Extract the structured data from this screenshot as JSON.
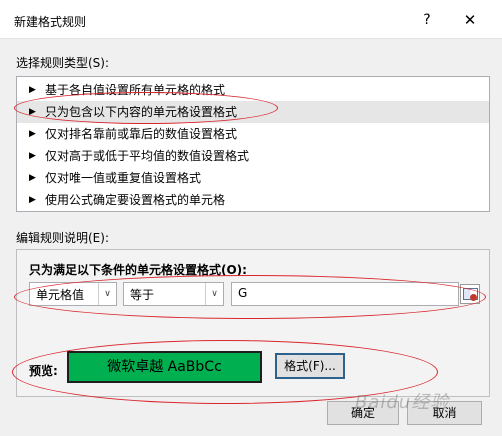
{
  "dialog": {
    "title": "新建格式规则",
    "help": "?",
    "close": "✕"
  },
  "rule_type": {
    "label": "选择规则类型(S):",
    "items": [
      {
        "label": "基于各自值设置所有单元格的格式",
        "selected": false
      },
      {
        "label": "只为包含以下内容的单元格设置格式",
        "selected": true
      },
      {
        "label": "仅对排名靠前或靠后的数值设置格式",
        "selected": false
      },
      {
        "label": "仅对高于或低于平均值的数值设置格式",
        "selected": false
      },
      {
        "label": "仅对唯一值或重复值设置格式",
        "selected": false
      },
      {
        "label": "使用公式确定要设置格式的单元格",
        "selected": false
      }
    ]
  },
  "rule_desc": {
    "label": "编辑规则说明(E):",
    "condition_title": "只为满足以下条件的单元格设置格式(O):",
    "field_select": "单元格值",
    "operator_select": "等于",
    "value": "G",
    "preview_label": "预览:",
    "preview_text": "微软卓越  AaBbCc",
    "preview_color": "#00b050",
    "format_button": "格式(F)..."
  },
  "buttons": {
    "ok": "确定",
    "cancel": "取消"
  },
  "watermark": "Baidu经验",
  "annotation_color": "#d9272e"
}
